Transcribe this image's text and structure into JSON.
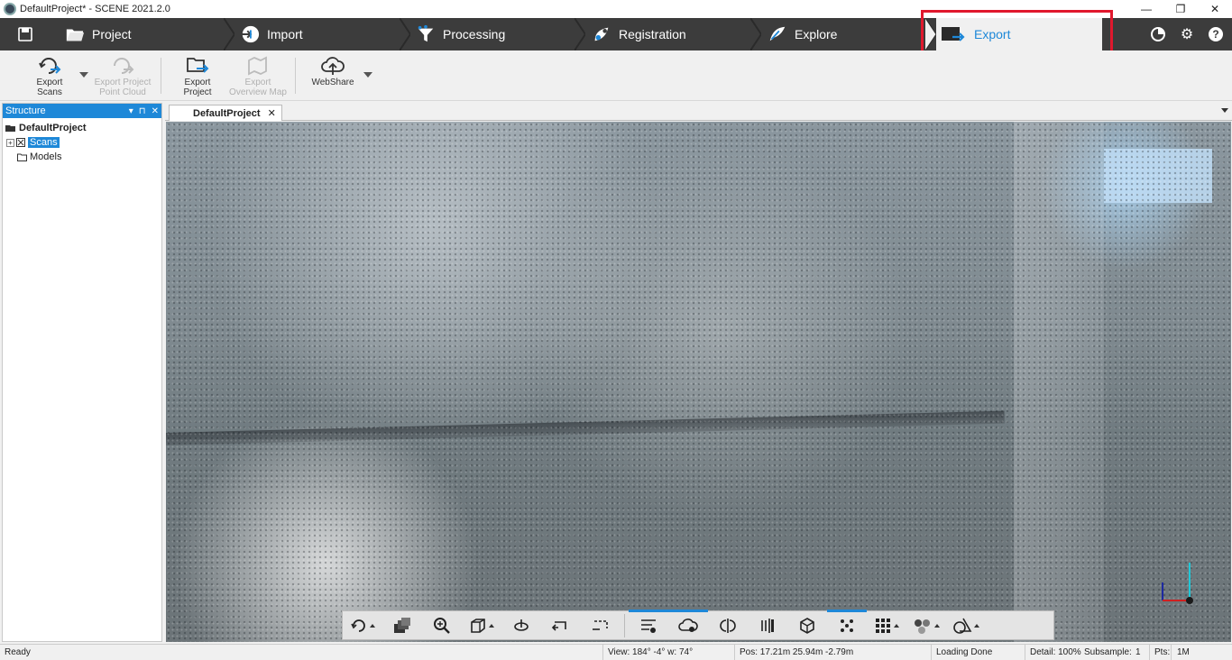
{
  "window": {
    "title": "DefaultProject* - SCENE 2021.2.0",
    "buttons": [
      "—",
      "❐",
      "✕"
    ]
  },
  "tabs": [
    {
      "label": "Project",
      "icon": "folder-icon"
    },
    {
      "label": "Import",
      "icon": "import-icon"
    },
    {
      "label": "Processing",
      "icon": "processing-icon"
    },
    {
      "label": "Registration",
      "icon": "registration-icon"
    },
    {
      "label": "Explore",
      "icon": "explore-icon"
    },
    {
      "label": "Export",
      "icon": "export-icon",
      "active": true
    }
  ],
  "ribbon": {
    "export_scans": "Export Scans",
    "export_project_point_cloud_1": "Export Project",
    "export_project_point_cloud_2": "Point Cloud",
    "export_project": "Export Project",
    "export_overview_map_1": "Export",
    "export_overview_map_2": "Overview Map",
    "webshare": "WebShare"
  },
  "structure": {
    "title": "Structure",
    "buttons": [
      "▾",
      "⊓",
      "✕"
    ],
    "root": "DefaultProject",
    "items": [
      {
        "label": "Scans",
        "selected": true
      },
      {
        "label": "Models",
        "selected": false
      }
    ]
  },
  "document": {
    "tab_label": "DefaultProject",
    "close": "✕"
  },
  "statusbar": {
    "status": "Ready",
    "view": "View: 184° -4° w: 74°",
    "pos": "Pos: 17.21m 25.94m -2.79m",
    "loading": "Loading Done",
    "detail": "Detail: 100%",
    "subsample": "Subsample:",
    "subsample_val": "1",
    "pts": "Pts:",
    "pts_val": "1M"
  },
  "colors": {
    "accent": "#1e88d8",
    "tabbar": "#3c3c3c",
    "highlight": "#e0182d"
  }
}
